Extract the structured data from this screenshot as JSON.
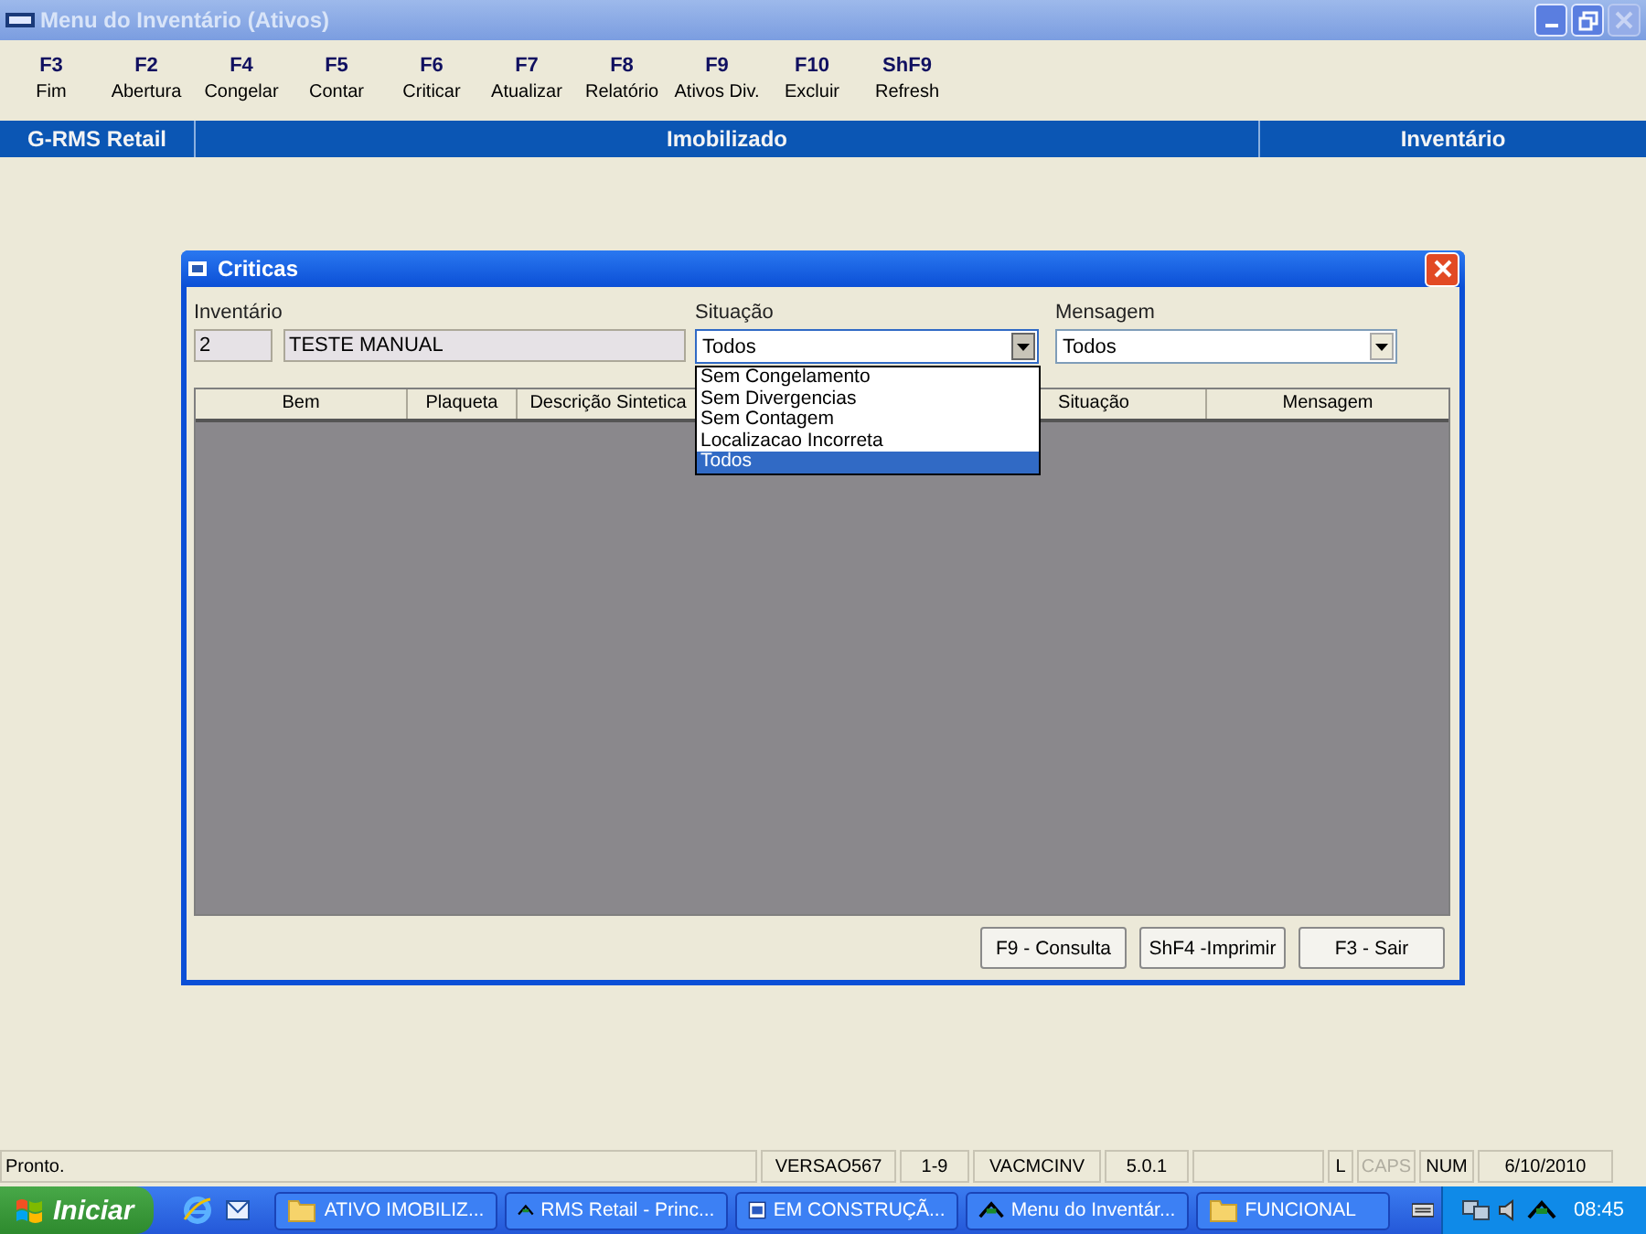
{
  "window": {
    "title": "Menu do Inventário (Ativos)",
    "active": false
  },
  "function_keys": [
    {
      "key": "F3",
      "label": "Fim"
    },
    {
      "key": "F2",
      "label": "Abertura"
    },
    {
      "key": "F4",
      "label": "Congelar"
    },
    {
      "key": "F5",
      "label": "Contar"
    },
    {
      "key": "F6",
      "label": "Criticar"
    },
    {
      "key": "F7",
      "label": "Atualizar"
    },
    {
      "key": "F8",
      "label": "Relatório"
    },
    {
      "key": "F9",
      "label": "Ativos Div."
    },
    {
      "key": "F10",
      "label": "Excluir"
    },
    {
      "key": "ShF9",
      "label": "Refresh"
    }
  ],
  "header_band": [
    "G-RMS Retail",
    "Imobilizado",
    "Inventário"
  ],
  "dialog": {
    "title": "Criticas",
    "inventario": {
      "label": "Inventário",
      "number": "2",
      "name": "TESTE MANUAL"
    },
    "situacao": {
      "label": "Situação",
      "value": "Todos",
      "expanded": true,
      "options": [
        {
          "label": "Sem Congelamento",
          "selected": false
        },
        {
          "label": "Sem Divergencias",
          "selected": false
        },
        {
          "label": "Sem Contagem",
          "selected": false
        },
        {
          "label": "Localizacao Incorreta",
          "selected": false
        },
        {
          "label": "Todos",
          "selected": true
        }
      ]
    },
    "mensagem": {
      "label": "Mensagem",
      "value": "Todos"
    },
    "grid": {
      "columns": [
        "Bem",
        "Plaqueta",
        "Descrição Sintetica",
        "Situação",
        "Mensagem"
      ]
    },
    "buttons": [
      "F9 - Consulta",
      "ShF4 -Imprimir",
      "F3 - Sair"
    ]
  },
  "status_bar": [
    {
      "text": "Pronto.",
      "disabled": false
    },
    {
      "text": "VERSAO567",
      "disabled": false
    },
    {
      "text": "1-9",
      "disabled": false
    },
    {
      "text": "VACMCINV",
      "disabled": false
    },
    {
      "text": "5.0.1",
      "disabled": false
    },
    {
      "text": "L",
      "disabled": false
    },
    {
      "text": "CAPS",
      "disabled": true
    },
    {
      "text": "NUM",
      "disabled": false
    },
    {
      "text": "6/10/2010",
      "disabled": false
    }
  ],
  "taskbar": {
    "start": "Iniciar",
    "tasks": [
      {
        "kind": "folder",
        "label": "ATIVO IMOBILIZ..."
      },
      {
        "kind": "app",
        "label": "RMS Retail - Princ..."
      },
      {
        "kind": "document",
        "label": "EM CONSTRUÇÃ..."
      },
      {
        "kind": "app",
        "label": "Menu do Inventár..."
      },
      {
        "kind": "folder",
        "label": "FUNCIONAL"
      }
    ],
    "clock": "08:45"
  }
}
